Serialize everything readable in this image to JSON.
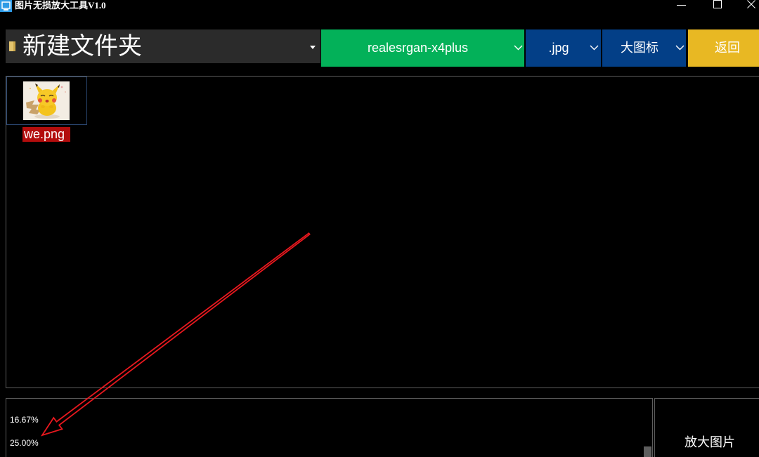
{
  "window": {
    "title": "图片无损放大工具V1.0",
    "icons": {
      "app": "app-icon",
      "minimize": "minimize-icon",
      "maximize": "maximize-icon",
      "close": "close-icon"
    }
  },
  "toolbar": {
    "folder_select": {
      "value": "新建文件夹",
      "icon": "folder-icon",
      "arrow_icon": "dropdown-arrow-icon"
    },
    "model_select": {
      "value": "realesrgan-x4plus",
      "color": "#03b159",
      "icon": "chevron-down-icon"
    },
    "format_select": {
      "value": ".jpg",
      "color": "#033f87",
      "icon": "chevron-down-icon"
    },
    "view_select": {
      "value": "大图标",
      "color": "#033f87",
      "icon": "chevron-down-icon"
    },
    "back_button": {
      "label": "返回",
      "color": "#e8b823"
    }
  },
  "file_browser": {
    "files": [
      {
        "name": "we.png",
        "thumbnail": "pikachu-image",
        "selected": true,
        "label_color": "#b30d0d"
      }
    ]
  },
  "progress_log": {
    "lines": [
      "16.67%",
      "25.00%"
    ]
  },
  "upscale_button": {
    "label": "放大图片"
  },
  "annotation": {
    "icon": "red-arrow",
    "color": "#e8181e"
  }
}
